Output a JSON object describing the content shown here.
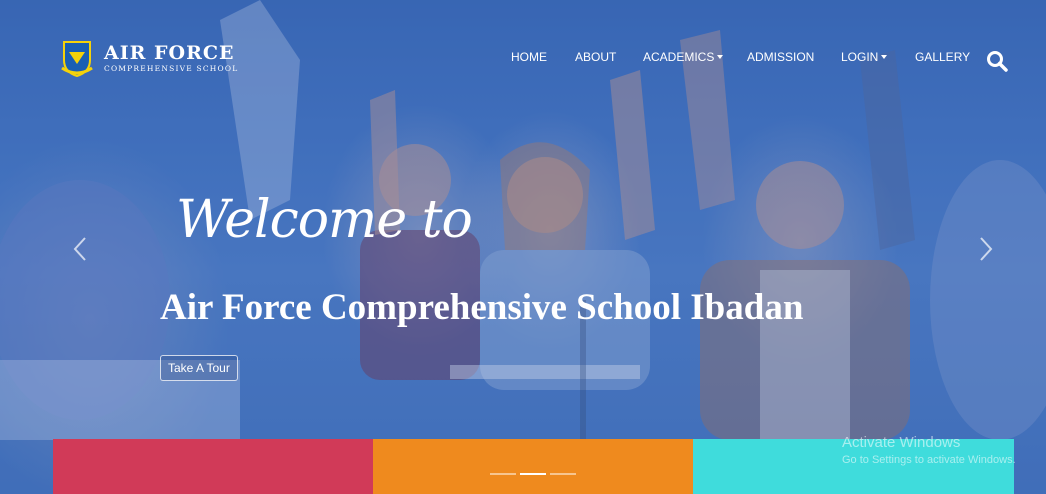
{
  "brand": {
    "name": "AIR FORCE",
    "subtitle": "COMPREHENSIVE SCHOOL",
    "colors": {
      "crest_blue": "#1a5fb4",
      "crest_yellow": "#f5d20a"
    }
  },
  "nav": {
    "items": [
      {
        "label": "HOME",
        "has_dropdown": false
      },
      {
        "label": "ABOUT",
        "has_dropdown": false
      },
      {
        "label": "ACADEMICS",
        "has_dropdown": true
      },
      {
        "label": "ADMISSION",
        "has_dropdown": false
      },
      {
        "label": "LOGIN",
        "has_dropdown": true
      },
      {
        "label": "GALLERY",
        "has_dropdown": false
      }
    ],
    "search_icon": "search-icon"
  },
  "hero": {
    "welcome": "Welcome to",
    "headline": "Air Force Comprehensive School Ibadan",
    "cta_label": "Take A Tour",
    "prev_icon": "chevron-left-icon",
    "next_icon": "chevron-right-icon",
    "slide_count": 3,
    "active_slide": 2
  },
  "cards": {
    "colors": [
      "#d13a58",
      "#ef8a1e",
      "#3fdcdc"
    ]
  },
  "os_watermark": {
    "title": "Activate Windows",
    "subtitle": "Go to Settings to activate Windows."
  }
}
